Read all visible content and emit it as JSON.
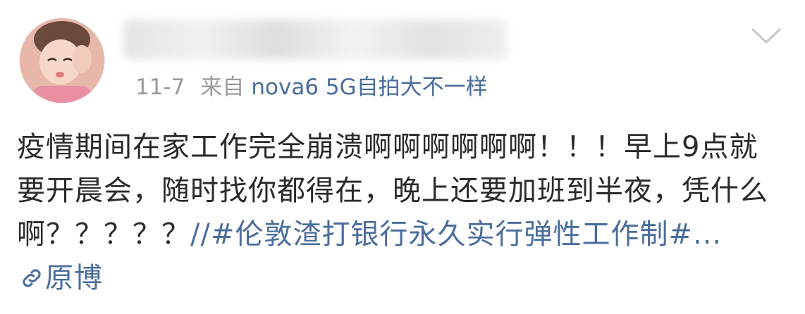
{
  "post": {
    "username": "███████████████",
    "date": "11-7",
    "from_label": "来自",
    "source": "nova6 5G自拍大不一样",
    "text": "疫情期间在家工作完全崩溃啊啊啊啊啊啊！！！早上9点就要开晨会，随时找你都得在，晚上还要加班到半夜，凭什么啊？？？？？",
    "slashes": "//",
    "hashtag": "#伦敦渣打银行永久实行弹性工作制#...",
    "origin_label": "原博"
  },
  "icons": {
    "avatar": "avatar-photo",
    "menu": "chevron-down-icon",
    "link": "link-icon"
  },
  "colors": {
    "link": "#4a6d9c",
    "meta": "#9a9a9a",
    "text": "#2a2a2a"
  }
}
